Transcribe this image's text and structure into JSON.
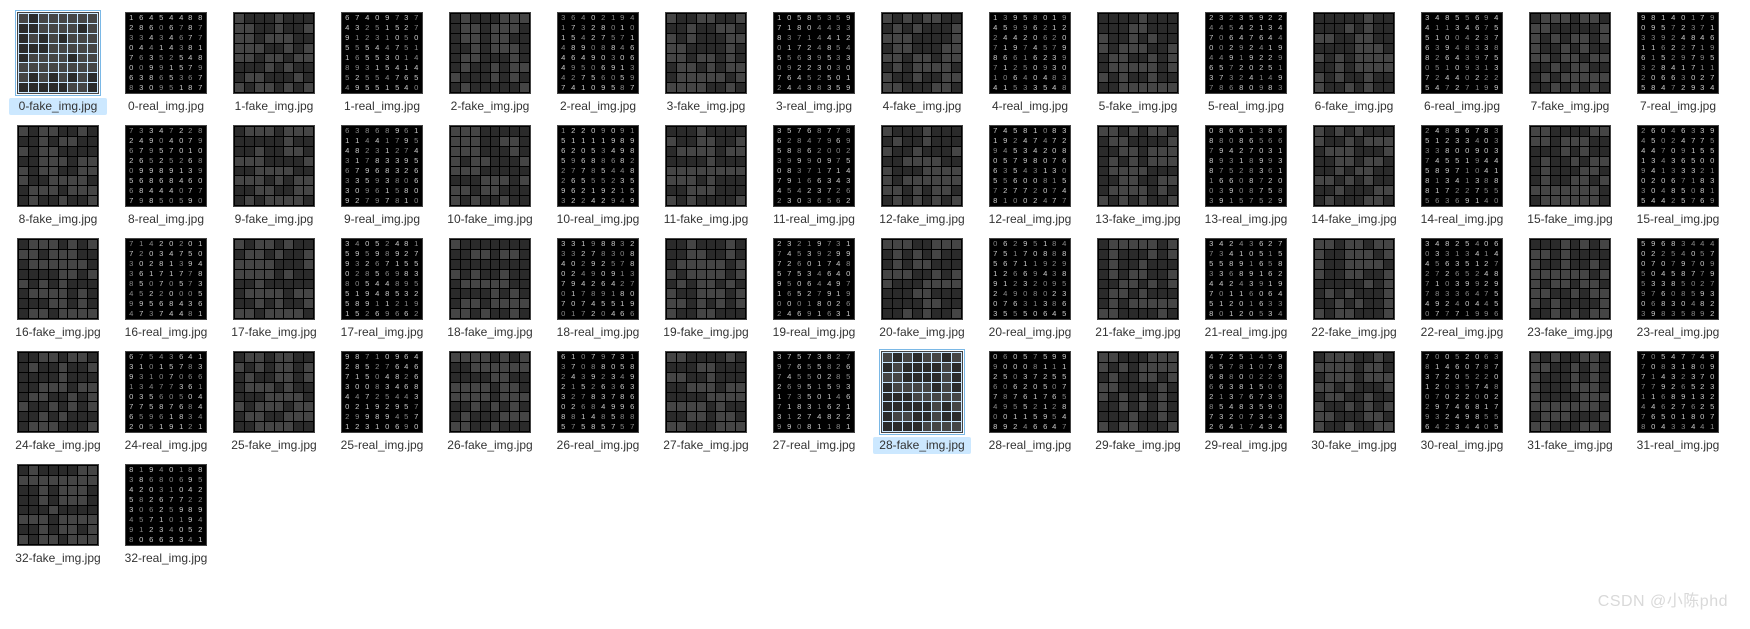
{
  "watermark": "CSDN @小陈phd",
  "selected": [
    "0-fake_img.jpg",
    "28-fake_img.jpg"
  ],
  "files": [
    {
      "name": "0-fake_img.jpg",
      "kind": "fake"
    },
    {
      "name": "0-real_img.jpg",
      "kind": "real"
    },
    {
      "name": "1-fake_img.jpg",
      "kind": "fake"
    },
    {
      "name": "1-real_img.jpg",
      "kind": "real"
    },
    {
      "name": "2-fake_img.jpg",
      "kind": "fake"
    },
    {
      "name": "2-real_img.jpg",
      "kind": "real"
    },
    {
      "name": "3-fake_img.jpg",
      "kind": "fake"
    },
    {
      "name": "3-real_img.jpg",
      "kind": "real"
    },
    {
      "name": "4-fake_img.jpg",
      "kind": "fake"
    },
    {
      "name": "4-real_img.jpg",
      "kind": "real"
    },
    {
      "name": "5-fake_img.jpg",
      "kind": "fake"
    },
    {
      "name": "5-real_img.jpg",
      "kind": "real"
    },
    {
      "name": "6-fake_img.jpg",
      "kind": "fake"
    },
    {
      "name": "6-real_img.jpg",
      "kind": "real"
    },
    {
      "name": "7-fake_img.jpg",
      "kind": "fake"
    },
    {
      "name": "7-real_img.jpg",
      "kind": "real"
    },
    {
      "name": "8-fake_img.jpg",
      "kind": "fake"
    },
    {
      "name": "8-real_img.jpg",
      "kind": "real"
    },
    {
      "name": "9-fake_img.jpg",
      "kind": "fake"
    },
    {
      "name": "9-real_img.jpg",
      "kind": "real"
    },
    {
      "name": "10-fake_img.jpg",
      "kind": "fake"
    },
    {
      "name": "10-real_img.jpg",
      "kind": "real"
    },
    {
      "name": "11-fake_img.jpg",
      "kind": "fake"
    },
    {
      "name": "11-real_img.jpg",
      "kind": "real"
    },
    {
      "name": "12-fake_img.jpg",
      "kind": "fake"
    },
    {
      "name": "12-real_img.jpg",
      "kind": "real"
    },
    {
      "name": "13-fake_img.jpg",
      "kind": "fake"
    },
    {
      "name": "13-real_img.jpg",
      "kind": "real"
    },
    {
      "name": "14-fake_img.jpg",
      "kind": "fake"
    },
    {
      "name": "14-real_img.jpg",
      "kind": "real"
    },
    {
      "name": "15-fake_img.jpg",
      "kind": "fake"
    },
    {
      "name": "15-real_img.jpg",
      "kind": "real"
    },
    {
      "name": "16-fake_img.jpg",
      "kind": "fake"
    },
    {
      "name": "16-real_img.jpg",
      "kind": "real"
    },
    {
      "name": "17-fake_img.jpg",
      "kind": "fake"
    },
    {
      "name": "17-real_img.jpg",
      "kind": "real"
    },
    {
      "name": "18-fake_img.jpg",
      "kind": "fake"
    },
    {
      "name": "18-real_img.jpg",
      "kind": "real"
    },
    {
      "name": "19-fake_img.jpg",
      "kind": "fake"
    },
    {
      "name": "19-real_img.jpg",
      "kind": "real"
    },
    {
      "name": "20-fake_img.jpg",
      "kind": "fake"
    },
    {
      "name": "20-real_img.jpg",
      "kind": "real"
    },
    {
      "name": "21-fake_img.jpg",
      "kind": "fake"
    },
    {
      "name": "21-real_img.jpg",
      "kind": "real"
    },
    {
      "name": "22-fake_img.jpg",
      "kind": "fake"
    },
    {
      "name": "22-real_img.jpg",
      "kind": "real"
    },
    {
      "name": "23-fake_img.jpg",
      "kind": "fake"
    },
    {
      "name": "23-real_img.jpg",
      "kind": "real"
    },
    {
      "name": "24-fake_img.jpg",
      "kind": "fake"
    },
    {
      "name": "24-real_img.jpg",
      "kind": "real"
    },
    {
      "name": "25-fake_img.jpg",
      "kind": "fake"
    },
    {
      "name": "25-real_img.jpg",
      "kind": "real"
    },
    {
      "name": "26-fake_img.jpg",
      "kind": "fake"
    },
    {
      "name": "26-real_img.jpg",
      "kind": "real"
    },
    {
      "name": "27-fake_img.jpg",
      "kind": "fake"
    },
    {
      "name": "27-real_img.jpg",
      "kind": "real"
    },
    {
      "name": "28-fake_img.jpg",
      "kind": "fake"
    },
    {
      "name": "28-real_img.jpg",
      "kind": "real"
    },
    {
      "name": "29-fake_img.jpg",
      "kind": "fake"
    },
    {
      "name": "29-real_img.jpg",
      "kind": "real"
    },
    {
      "name": "30-fake_img.jpg",
      "kind": "fake"
    },
    {
      "name": "30-real_img.jpg",
      "kind": "real"
    },
    {
      "name": "31-fake_img.jpg",
      "kind": "fake"
    },
    {
      "name": "31-real_img.jpg",
      "kind": "real"
    },
    {
      "name": "32-fake_img.jpg",
      "kind": "fake"
    },
    {
      "name": "32-real_img.jpg",
      "kind": "real"
    }
  ]
}
